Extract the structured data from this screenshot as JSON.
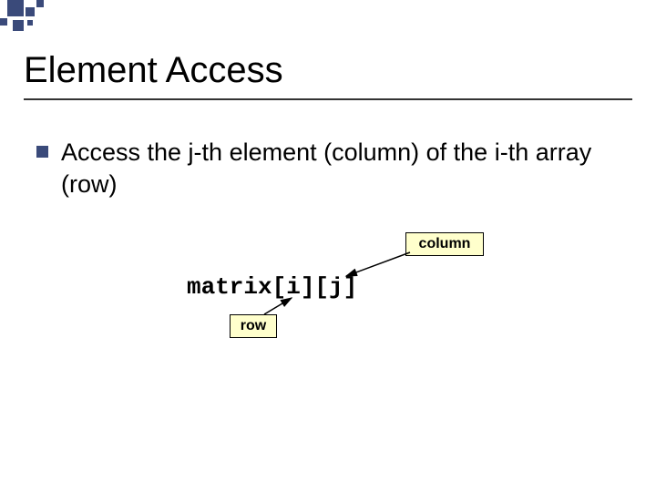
{
  "slide": {
    "title": "Element Access",
    "bullet": "Access the j-th element (column) of the     i-th array (row)",
    "code": "matrix[i][j]",
    "label_column": "column",
    "label_row": "row"
  }
}
